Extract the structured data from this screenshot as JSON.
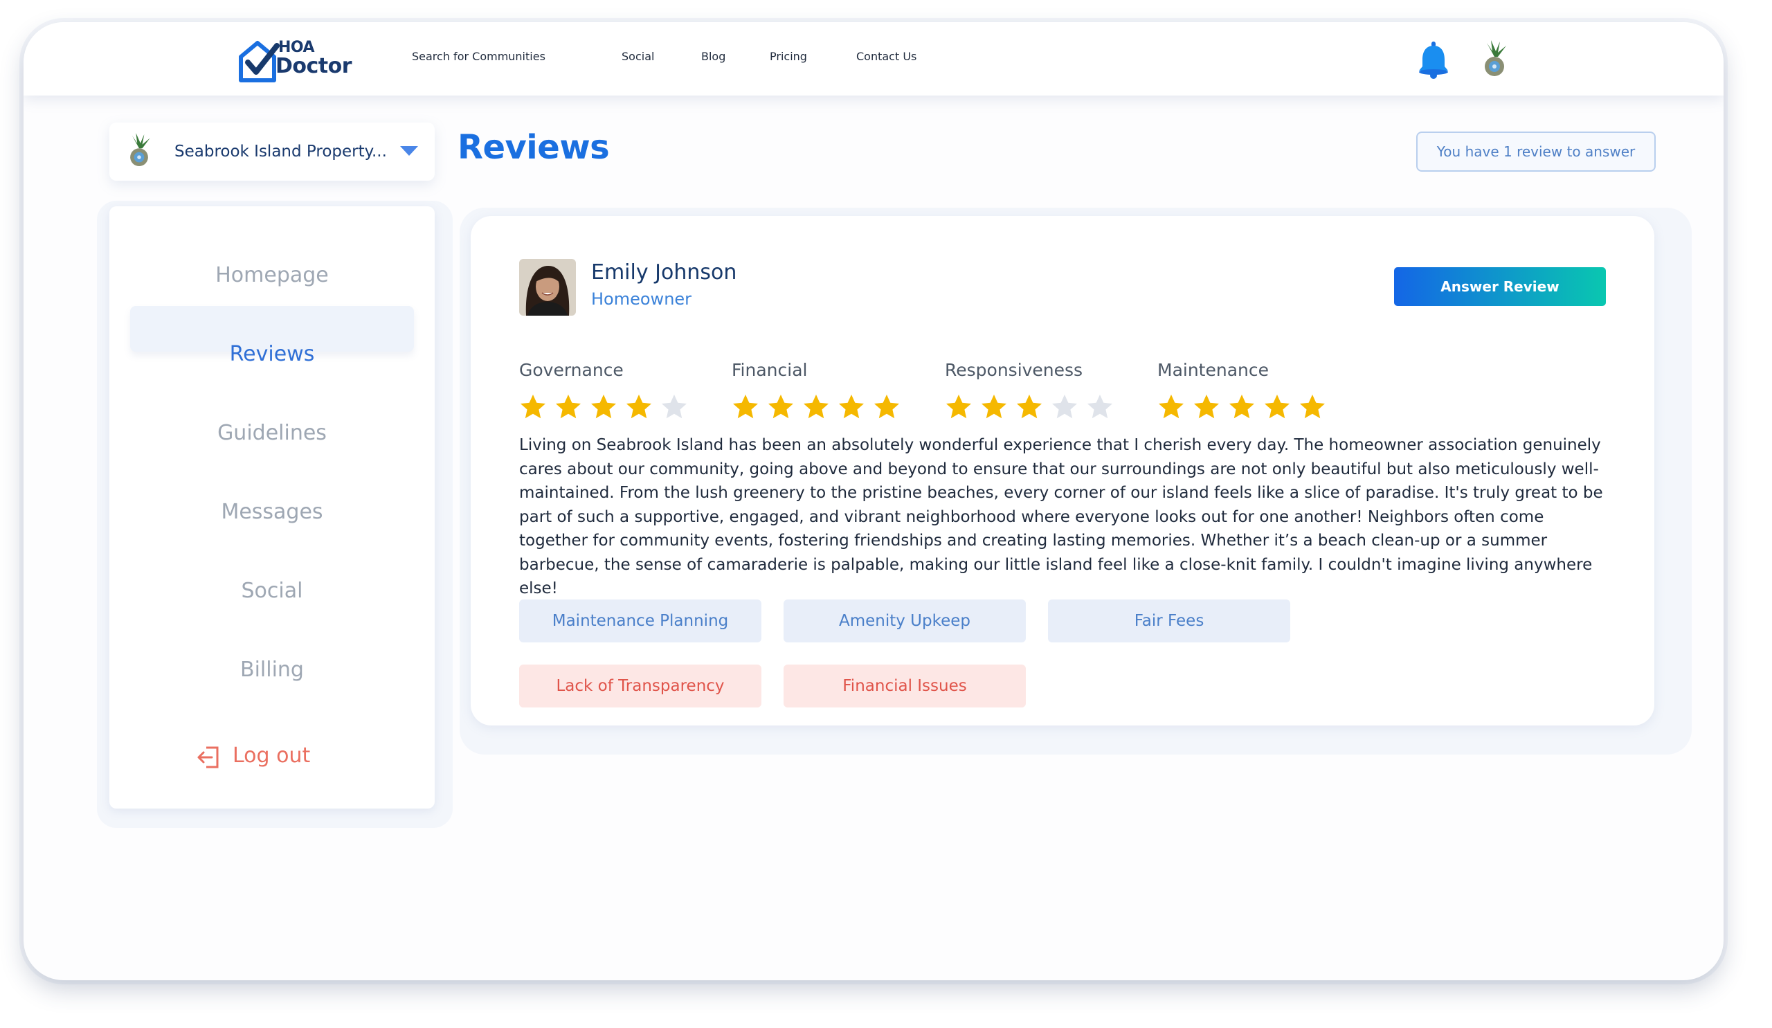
{
  "app": {
    "logo_line1": "HOA",
    "logo_line2": "Doctor",
    "nav": [
      "Search for Communities",
      "Social",
      "Blog",
      "Pricing",
      "Contact Us"
    ]
  },
  "community_selector": {
    "label": "Seabrook Island Property..."
  },
  "page": {
    "title": "Reviews",
    "notice": "You have 1 review to answer"
  },
  "sidebar": {
    "items": [
      {
        "label": "Homepage"
      },
      {
        "label": "Reviews"
      },
      {
        "label": "Guidelines"
      },
      {
        "label": "Messages"
      },
      {
        "label": "Social"
      },
      {
        "label": "Billing"
      }
    ],
    "active": "Reviews",
    "logout_label": "Log out"
  },
  "review": {
    "reviewer_name": "Emily Johnson",
    "reviewer_role": "Homeowner",
    "answer_button": "Answer Review",
    "ratings": [
      {
        "category": "Governance",
        "stars": 4,
        "max": 5
      },
      {
        "category": "Financial",
        "stars": 5,
        "max": 5
      },
      {
        "category": "Responsiveness",
        "stars": 3,
        "max": 5
      },
      {
        "category": "Maintenance",
        "stars": 5,
        "max": 5
      }
    ],
    "text": "Living on Seabrook Island has been an absolutely wonderful experience that I cherish every day. The homeowner association genuinely cares about our community, going above and beyond to ensure that our surroundings are not only beautiful but also meticulously well-maintained. From the lush greenery to the pristine beaches, every corner of our island feels like a slice of paradise. It's truly great to be part of such a supportive, engaged, and vibrant neighborhood where everyone looks out for one another! Neighbors often come together for community events, fostering friendships and creating lasting memories. Whether it’s a beach clean-up or a summer barbecue, the sense of camaraderie is palpable, making our little island feel like a close-knit family. I couldn't imagine living anywhere else!",
    "positive_tags": [
      "Maintenance Planning",
      "Amenity Upkeep",
      "Fair Fees"
    ],
    "negative_tags": [
      "Lack of Transparency",
      "Financial Issues"
    ]
  },
  "colors": {
    "accent": "#1a6fe0",
    "star_filled": "#f5b800",
    "star_empty": "#dfe3ea",
    "negative": "#e0544a",
    "logout": "#ea6f60"
  },
  "icons": {
    "logo": "checkmark-house-logo",
    "notification": "bell-icon",
    "avatar": "pineapple-avatar",
    "dropdown": "caret-down-icon",
    "logout": "logout-icon",
    "rating": "star-icon"
  }
}
